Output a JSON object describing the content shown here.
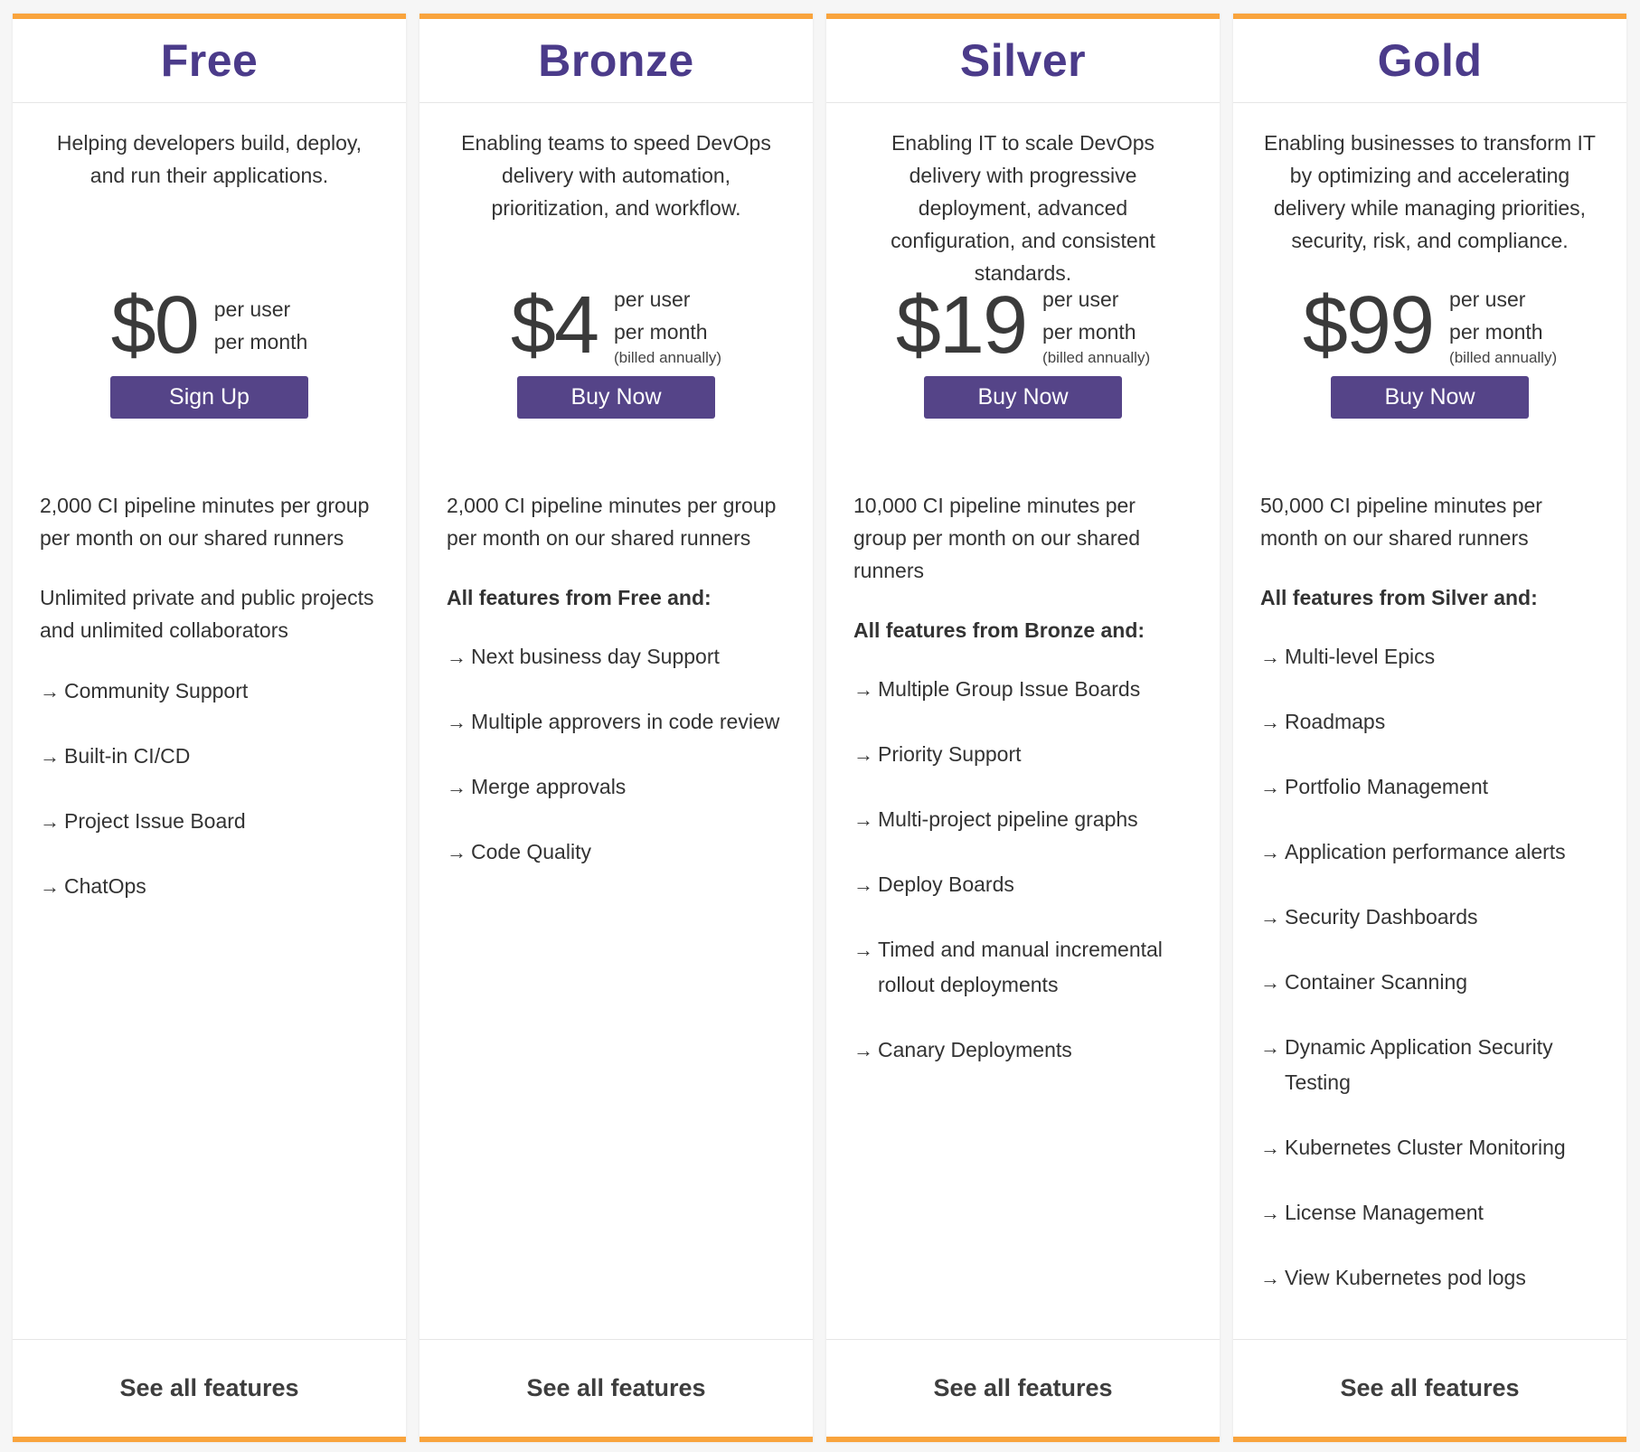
{
  "plans": [
    {
      "name": "Free",
      "description": "Helping developers build, deploy, and run their applications.",
      "price": "$0",
      "per_user": "per user",
      "per_month": "per month",
      "billed_note": "",
      "cta_label": "Sign Up",
      "paragraphs": [
        "2,000 CI pipeline minutes per group per month on our shared runners",
        "Unlimited private and public projects and unlimited collaborators"
      ],
      "includes_heading": "",
      "features": [
        "Community Support",
        "Built-in CI/CD",
        "Project Issue Board",
        "ChatOps"
      ],
      "footer_link": "See all features"
    },
    {
      "name": "Bronze",
      "description": "Enabling teams to speed DevOps delivery with automation, prioritization, and workflow.",
      "price": "$4",
      "per_user": "per user",
      "per_month": "per month",
      "billed_note": "(billed annually)",
      "cta_label": "Buy Now",
      "paragraphs": [
        "2,000 CI pipeline minutes per group per month on our shared runners"
      ],
      "includes_heading": "All features from Free and:",
      "features": [
        "Next business day Support",
        "Multiple approvers in code review",
        "Merge approvals",
        "Code Quality"
      ],
      "footer_link": "See all features"
    },
    {
      "name": "Silver",
      "description": "Enabling IT to scale DevOps delivery with progressive deployment, advanced configuration, and consistent standards.",
      "price": "$19",
      "per_user": "per user",
      "per_month": "per month",
      "billed_note": "(billed annually)",
      "cta_label": "Buy Now",
      "paragraphs": [
        "10,000 CI pipeline minutes per group per month on our shared runners"
      ],
      "includes_heading": "All features from Bronze and:",
      "features": [
        "Multiple Group Issue Boards",
        "Priority Support",
        "Multi-project pipeline graphs",
        "Deploy Boards",
        "Timed and manual incremental rollout deployments",
        "Canary Deployments"
      ],
      "footer_link": "See all features"
    },
    {
      "name": "Gold",
      "description": "Enabling businesses to transform IT by optimizing and accelerating delivery while managing priorities, security, risk, and compliance.",
      "price": "$99",
      "per_user": "per user",
      "per_month": "per month",
      "billed_note": "(billed annually)",
      "cta_label": "Buy Now",
      "paragraphs": [
        "50,000 CI pipeline minutes per month on our shared runners"
      ],
      "includes_heading": "All features from Silver and:",
      "features": [
        "Multi-level Epics",
        "Roadmaps",
        "Portfolio Management",
        "Application performance alerts",
        "Security Dashboards",
        "Container Scanning",
        "Dynamic Application Security Testing",
        "Kubernetes Cluster Monitoring",
        "License Management",
        "View Kubernetes pod logs"
      ],
      "footer_link": "See all features"
    }
  ],
  "arrow_glyph": "→",
  "colors": {
    "accent": "#f9a43d",
    "title": "#4b3b8a",
    "button": "#554488",
    "background": "#f6f6f6"
  }
}
